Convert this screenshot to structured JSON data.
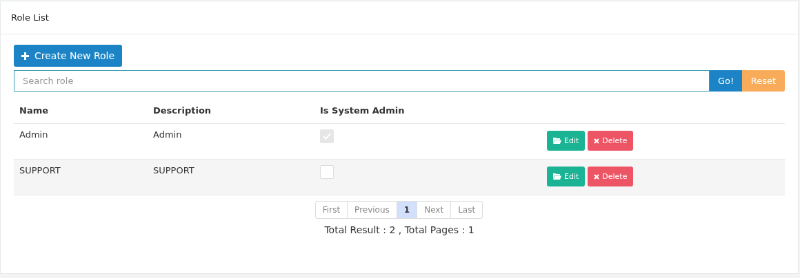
{
  "panel": {
    "title": "Role List"
  },
  "create_button": {
    "label": "Create New Role"
  },
  "search": {
    "placeholder": "Search role",
    "go": "Go!",
    "reset": "Reset"
  },
  "table": {
    "columns": [
      "Name",
      "Description",
      "Is System Admin"
    ],
    "rows": [
      {
        "name": "Admin",
        "description": "Admin",
        "is_system_admin": true,
        "edit": "Edit",
        "delete": "Delete"
      },
      {
        "name": "SUPPORT",
        "description": "SUPPORT",
        "is_system_admin": false,
        "edit": "Edit",
        "delete": "Delete"
      }
    ]
  },
  "pagination": [
    {
      "label": "First",
      "selected": false
    },
    {
      "label": "Previous",
      "selected": false
    },
    {
      "label": "1",
      "selected": true
    },
    {
      "label": "Next",
      "selected": false
    },
    {
      "label": "Last",
      "selected": false
    }
  ],
  "summary": "Total Result : 2 , Total Pages : 1"
}
